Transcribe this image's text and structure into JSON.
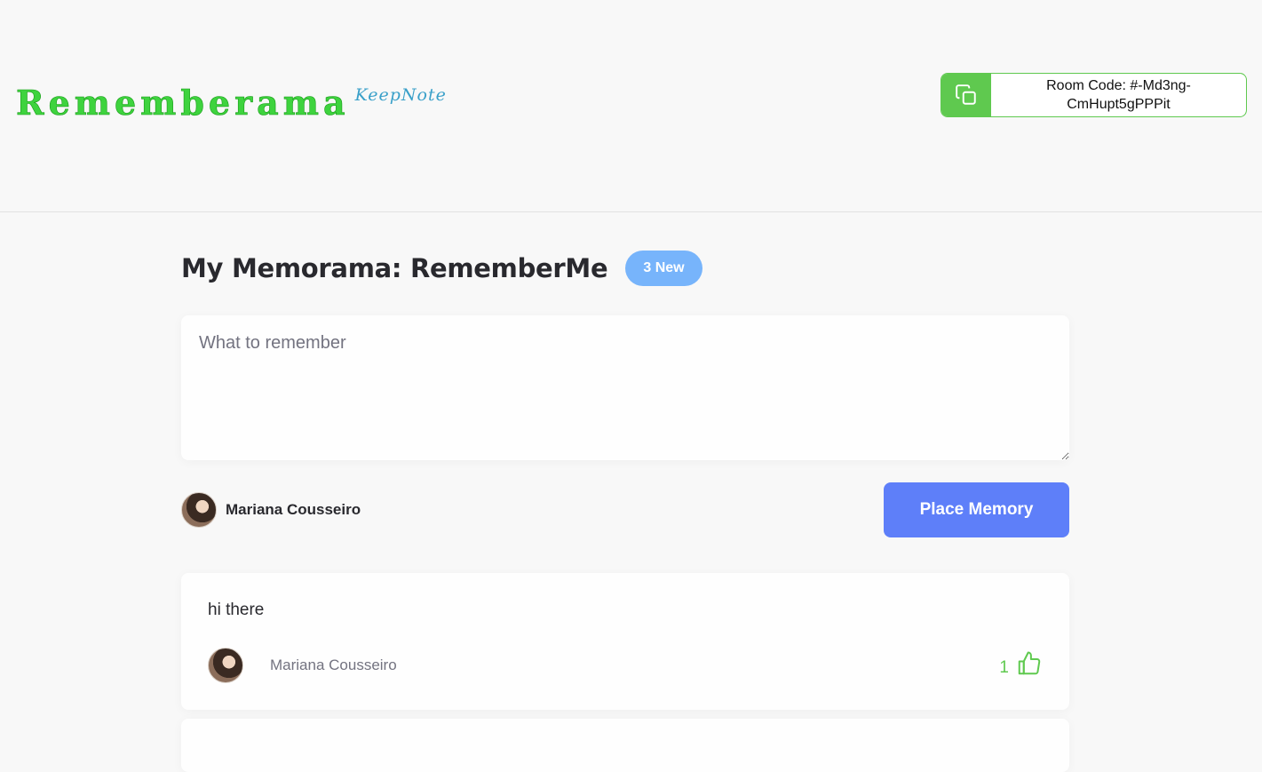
{
  "header": {
    "logo_text": "Rememberama",
    "logo_sub": "KeepNote",
    "room_code_label": "Room Code: #-Md3ng-CmHupt5gPPPit"
  },
  "main": {
    "title": "My Memorama: RememberMe",
    "new_badge": "3 New",
    "input_placeholder": "What to remember",
    "input_value": "",
    "user_name": "Mariana Cousseiro",
    "submit_label": "Place Memory"
  },
  "memories": [
    {
      "text": "hi there",
      "author": "Mariana Cousseiro",
      "likes": "1"
    }
  ],
  "colors": {
    "brand_green": "#5fc94f",
    "badge_blue": "#77b4fb",
    "button_blue": "#5e7ff9",
    "logo_green": "#3ed33e",
    "logo_sub_blue": "#3aa0c9"
  },
  "icons": {
    "room_code": "copy-icon",
    "like": "thumbs-up-icon"
  }
}
